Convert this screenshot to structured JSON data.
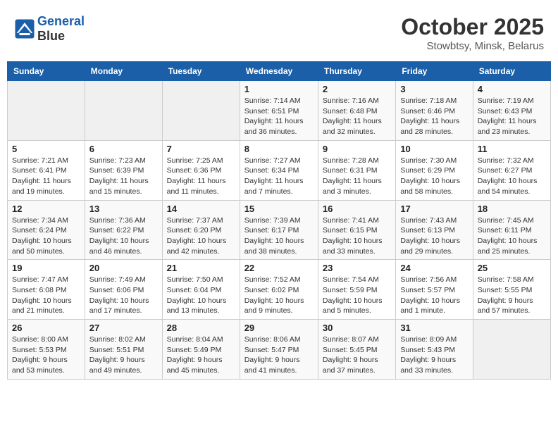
{
  "header": {
    "logo_line1": "General",
    "logo_line2": "Blue",
    "month": "October 2025",
    "location": "Stowbtsy, Minsk, Belarus"
  },
  "weekdays": [
    "Sunday",
    "Monday",
    "Tuesday",
    "Wednesday",
    "Thursday",
    "Friday",
    "Saturday"
  ],
  "weeks": [
    [
      {
        "day": "",
        "info": ""
      },
      {
        "day": "",
        "info": ""
      },
      {
        "day": "",
        "info": ""
      },
      {
        "day": "1",
        "info": "Sunrise: 7:14 AM\nSunset: 6:51 PM\nDaylight: 11 hours\nand 36 minutes."
      },
      {
        "day": "2",
        "info": "Sunrise: 7:16 AM\nSunset: 6:48 PM\nDaylight: 11 hours\nand 32 minutes."
      },
      {
        "day": "3",
        "info": "Sunrise: 7:18 AM\nSunset: 6:46 PM\nDaylight: 11 hours\nand 28 minutes."
      },
      {
        "day": "4",
        "info": "Sunrise: 7:19 AM\nSunset: 6:43 PM\nDaylight: 11 hours\nand 23 minutes."
      }
    ],
    [
      {
        "day": "5",
        "info": "Sunrise: 7:21 AM\nSunset: 6:41 PM\nDaylight: 11 hours\nand 19 minutes."
      },
      {
        "day": "6",
        "info": "Sunrise: 7:23 AM\nSunset: 6:39 PM\nDaylight: 11 hours\nand 15 minutes."
      },
      {
        "day": "7",
        "info": "Sunrise: 7:25 AM\nSunset: 6:36 PM\nDaylight: 11 hours\nand 11 minutes."
      },
      {
        "day": "8",
        "info": "Sunrise: 7:27 AM\nSunset: 6:34 PM\nDaylight: 11 hours\nand 7 minutes."
      },
      {
        "day": "9",
        "info": "Sunrise: 7:28 AM\nSunset: 6:31 PM\nDaylight: 11 hours\nand 3 minutes."
      },
      {
        "day": "10",
        "info": "Sunrise: 7:30 AM\nSunset: 6:29 PM\nDaylight: 10 hours\nand 58 minutes."
      },
      {
        "day": "11",
        "info": "Sunrise: 7:32 AM\nSunset: 6:27 PM\nDaylight: 10 hours\nand 54 minutes."
      }
    ],
    [
      {
        "day": "12",
        "info": "Sunrise: 7:34 AM\nSunset: 6:24 PM\nDaylight: 10 hours\nand 50 minutes."
      },
      {
        "day": "13",
        "info": "Sunrise: 7:36 AM\nSunset: 6:22 PM\nDaylight: 10 hours\nand 46 minutes."
      },
      {
        "day": "14",
        "info": "Sunrise: 7:37 AM\nSunset: 6:20 PM\nDaylight: 10 hours\nand 42 minutes."
      },
      {
        "day": "15",
        "info": "Sunrise: 7:39 AM\nSunset: 6:17 PM\nDaylight: 10 hours\nand 38 minutes."
      },
      {
        "day": "16",
        "info": "Sunrise: 7:41 AM\nSunset: 6:15 PM\nDaylight: 10 hours\nand 33 minutes."
      },
      {
        "day": "17",
        "info": "Sunrise: 7:43 AM\nSunset: 6:13 PM\nDaylight: 10 hours\nand 29 minutes."
      },
      {
        "day": "18",
        "info": "Sunrise: 7:45 AM\nSunset: 6:11 PM\nDaylight: 10 hours\nand 25 minutes."
      }
    ],
    [
      {
        "day": "19",
        "info": "Sunrise: 7:47 AM\nSunset: 6:08 PM\nDaylight: 10 hours\nand 21 minutes."
      },
      {
        "day": "20",
        "info": "Sunrise: 7:49 AM\nSunset: 6:06 PM\nDaylight: 10 hours\nand 17 minutes."
      },
      {
        "day": "21",
        "info": "Sunrise: 7:50 AM\nSunset: 6:04 PM\nDaylight: 10 hours\nand 13 minutes."
      },
      {
        "day": "22",
        "info": "Sunrise: 7:52 AM\nSunset: 6:02 PM\nDaylight: 10 hours\nand 9 minutes."
      },
      {
        "day": "23",
        "info": "Sunrise: 7:54 AM\nSunset: 5:59 PM\nDaylight: 10 hours\nand 5 minutes."
      },
      {
        "day": "24",
        "info": "Sunrise: 7:56 AM\nSunset: 5:57 PM\nDaylight: 10 hours\nand 1 minute."
      },
      {
        "day": "25",
        "info": "Sunrise: 7:58 AM\nSunset: 5:55 PM\nDaylight: 9 hours\nand 57 minutes."
      }
    ],
    [
      {
        "day": "26",
        "info": "Sunrise: 8:00 AM\nSunset: 5:53 PM\nDaylight: 9 hours\nand 53 minutes."
      },
      {
        "day": "27",
        "info": "Sunrise: 8:02 AM\nSunset: 5:51 PM\nDaylight: 9 hours\nand 49 minutes."
      },
      {
        "day": "28",
        "info": "Sunrise: 8:04 AM\nSunset: 5:49 PM\nDaylight: 9 hours\nand 45 minutes."
      },
      {
        "day": "29",
        "info": "Sunrise: 8:06 AM\nSunset: 5:47 PM\nDaylight: 9 hours\nand 41 minutes."
      },
      {
        "day": "30",
        "info": "Sunrise: 8:07 AM\nSunset: 5:45 PM\nDaylight: 9 hours\nand 37 minutes."
      },
      {
        "day": "31",
        "info": "Sunrise: 8:09 AM\nSunset: 5:43 PM\nDaylight: 9 hours\nand 33 minutes."
      },
      {
        "day": "",
        "info": ""
      }
    ]
  ]
}
